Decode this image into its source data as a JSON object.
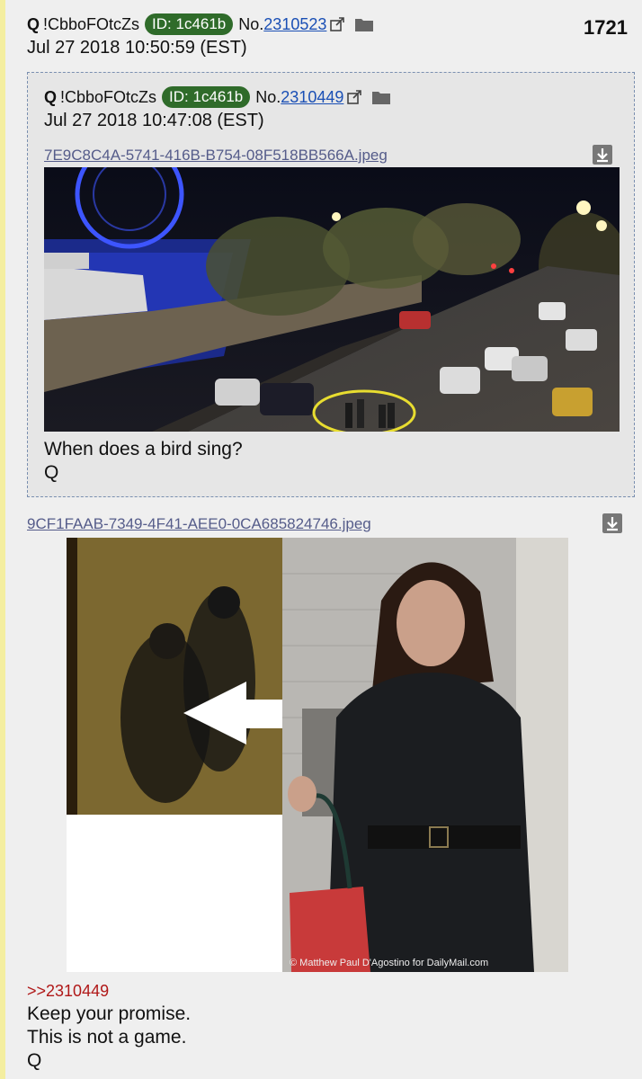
{
  "post": {
    "author": "Q",
    "tripcode": "!CbboFOtcZs",
    "id_badge": "ID: 1c461b",
    "no_label": "No.",
    "number": "2310523",
    "date": "Jul 27 2018 10:50:59 (EST)",
    "count": "1721",
    "file": "9CF1FAAB-7349-4F41-AEE0-0CA685824746.jpeg",
    "image_credit": "© Matthew Paul D'Agostino for DailyMail.com",
    "reply_ref": ">>2310449",
    "message_lines": [
      "Keep your promise.",
      "This is not a game.",
      "Q"
    ]
  },
  "quoted": {
    "author": "Q",
    "tripcode": "!CbboFOtcZs",
    "id_badge": "ID: 1c461b",
    "no_label": "No.",
    "number": "2310449",
    "date": "Jul 27 2018 10:47:08 (EST)",
    "file": "7E9C8C4A-5741-416B-B754-08F518BB566A.jpeg",
    "message_lines": [
      "When does a bird sing?",
      "Q"
    ]
  },
  "colors": {
    "id_badge": "#2f6b2a",
    "link": "#1a4fb5",
    "reply": "#b01818",
    "accent_bar": "#f4eea0"
  }
}
